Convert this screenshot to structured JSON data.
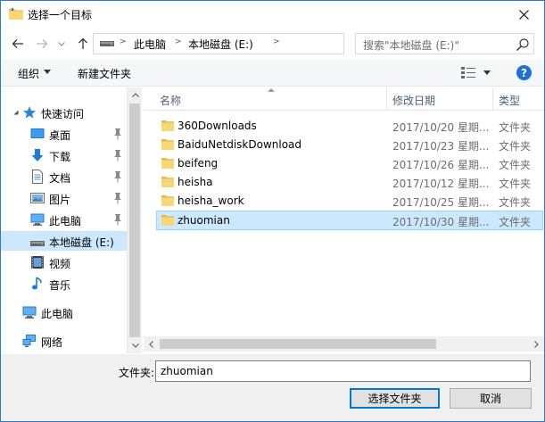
{
  "window": {
    "title": "选择一个目标"
  },
  "address": {
    "segments": [
      "此电脑",
      "本地磁盘 (E:)"
    ]
  },
  "search": {
    "placeholder": "搜索\"本地磁盘 (E:)\""
  },
  "toolbar": {
    "organize_label": "组织",
    "new_folder_label": "新建文件夹",
    "help_label": "?"
  },
  "navpane": {
    "quick_access_label": "快速访问",
    "items": [
      {
        "label": "桌面",
        "icon": "desktop-icon",
        "pinned": true
      },
      {
        "label": "下载",
        "icon": "download-icon",
        "pinned": true
      },
      {
        "label": "文档",
        "icon": "document-icon",
        "pinned": true
      },
      {
        "label": "图片",
        "icon": "picture-icon",
        "pinned": true
      },
      {
        "label": "此电脑",
        "icon": "computer-icon",
        "pinned": true
      },
      {
        "label": "本地磁盘 (E:)",
        "icon": "drive-icon",
        "pinned": false,
        "selected": true
      },
      {
        "label": "视频",
        "icon": "video-icon",
        "pinned": false
      },
      {
        "label": "音乐",
        "icon": "music-icon",
        "pinned": false
      }
    ],
    "this_pc_label": "此电脑",
    "network_label": "网络"
  },
  "filelist": {
    "columns": {
      "name": "名称",
      "modified": "修改日期",
      "type": "类型"
    },
    "rows": [
      {
        "name": "360Downloads",
        "modified": "2017/10/20 星期...",
        "type": "文件夹"
      },
      {
        "name": "BaiduNetdiskDownload",
        "modified": "2017/10/23 星期...",
        "type": "文件夹"
      },
      {
        "name": "beifeng",
        "modified": "2017/10/26 星期...",
        "type": "文件夹"
      },
      {
        "name": "heisha",
        "modified": "2017/10/12 星期...",
        "type": "文件夹"
      },
      {
        "name": "heisha_work",
        "modified": "2017/10/25 星期...",
        "type": "文件夹"
      },
      {
        "name": "zhuomian",
        "modified": "2017/10/30 星期...",
        "type": "文件夹",
        "selected": true
      }
    ]
  },
  "footer": {
    "folder_label": "文件夹:",
    "folder_value": "zhuomian",
    "select_button": "选择文件夹",
    "cancel_button": "取消"
  },
  "colors": {
    "accent": "#0078d7",
    "selection": "#cce8ff",
    "folder": "#f8d775",
    "help": "#1e6fd9"
  }
}
